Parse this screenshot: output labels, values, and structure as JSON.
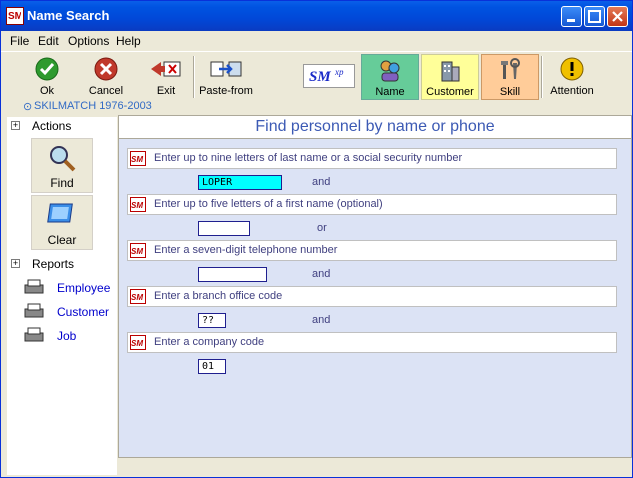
{
  "window": {
    "title": "Name Search"
  },
  "menu": [
    "File",
    "Edit",
    "Options",
    "Help"
  ],
  "toolbar": {
    "ok": "Ok",
    "cancel": "Cancel",
    "exit": "Exit",
    "paste_from": "Paste-from",
    "logo": "SMxp",
    "name": "Name",
    "customer": "Customer",
    "skill": "Skill",
    "attention": "Attention"
  },
  "strip": "SKILMATCH 1976-2003",
  "sidebar": {
    "actions_label": "Actions",
    "find_label": "Find",
    "clear_label": "Clear",
    "reports_label": "Reports",
    "reports": [
      "Employee",
      "Customer",
      "Job"
    ]
  },
  "main": {
    "title": "Find personnel by name or phone",
    "prompts": [
      {
        "label": "Enter up to nine letters of last name or a social security number",
        "value": "LOPER",
        "conj": "and"
      },
      {
        "label": "Enter up to five letters of a first name (optional)",
        "value": "",
        "conj": "or"
      },
      {
        "label": "Enter a seven-digit telephone number",
        "value": "",
        "conj": "and"
      },
      {
        "label": "Enter a branch office code",
        "value": "??",
        "conj": "and"
      },
      {
        "label": "Enter a company code",
        "value": "01",
        "conj": ""
      }
    ]
  },
  "colors": {
    "title_blue": "#0053e1",
    "highlight_field": "#00ffff",
    "name_tab": "#66cc99",
    "customer_tab": "#ffff99",
    "skill_tab": "#ffcc99"
  }
}
